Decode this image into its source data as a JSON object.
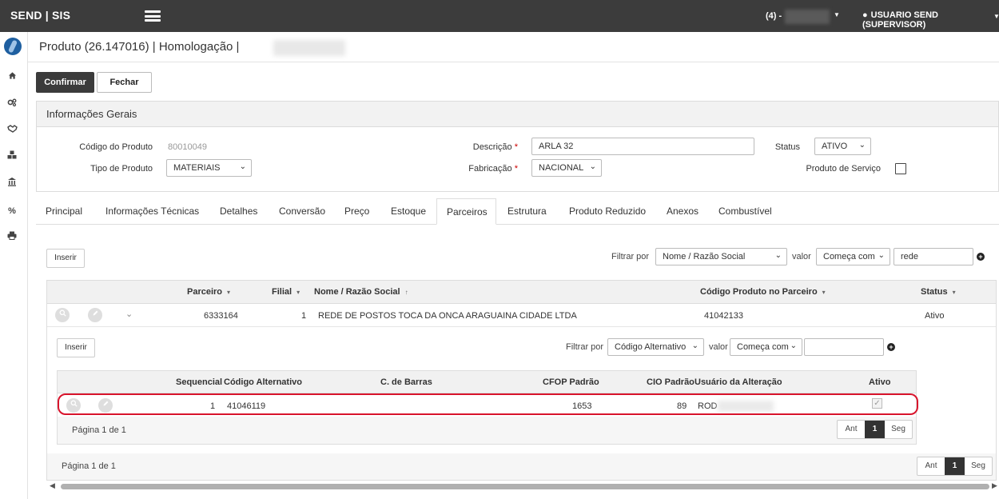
{
  "topbar": {
    "brand": "SEND | SIS",
    "count": "(4) -",
    "user": "USUARIO SEND (SUPERVISOR)"
  },
  "header": {
    "title": "Produto (26.147016) | Homologação |"
  },
  "toolbar": {
    "confirm_label": "Confirmar",
    "close_label": "Fechar"
  },
  "info": {
    "section_title": "Informações Gerais",
    "codigo_label": "Código do Produto",
    "codigo_value": "80010049",
    "tipo_label": "Tipo de Produto",
    "tipo_value": "MATERIAIS",
    "descricao_label": "Descrição",
    "descricao_value": "ARLA 32",
    "fabricacao_label": "Fabricação",
    "fabricacao_value": "NACIONAL",
    "status_label": "Status",
    "status_value": "ATIVO",
    "servico_label": "Produto de Serviço",
    "required_mark": "*"
  },
  "tabs": [
    "Principal",
    "Informações Técnicas",
    "Detalhes",
    "Conversão",
    "Preço",
    "Estoque",
    "Parceiros",
    "Estrutura",
    "Produto Reduzido",
    "Anexos",
    "Combustível"
  ],
  "active_tab": "Parceiros",
  "partners": {
    "insert_label": "Inserir",
    "filter_label": "Filtrar por",
    "filter_field": "Nome / Razão Social",
    "value_label": "valor",
    "filter_op": "Começa com",
    "filter_value": "rede",
    "columns": {
      "parceiro": "Parceiro",
      "filial": "Filial",
      "nome": "Nome / Razão Social",
      "codigo": "Código Produto no Parceiro",
      "status": "Status"
    },
    "rows": [
      {
        "parceiro": "6333164",
        "filial": "1",
        "nome": "REDE DE POSTOS TOCA DA ONCA ARAGUAINA CIDADE LTDA",
        "codigo": "41042133",
        "status": "Ativo"
      }
    ],
    "pagination_text": "Página 1 de 1",
    "pager": {
      "prev": "Ant",
      "page": "1",
      "next": "Seg"
    }
  },
  "alternatives": {
    "insert_label": "Inserir",
    "filter_label": "Filtrar por",
    "filter_field": "Código Alternativo",
    "value_label": "valor",
    "filter_op": "Começa com",
    "filter_value": "",
    "columns": {
      "sequencial": "Sequencial",
      "codigo_alt": "Código Alternativo",
      "barras": "C. de Barras",
      "cfop": "CFOP Padrão",
      "cio": "CIO Padrão",
      "usuario": "Usuário da Alteração",
      "ativo": "Ativo"
    },
    "rows": [
      {
        "sequencial": "1",
        "codigo_alt": "41046119",
        "barras": "",
        "cfop": "1653",
        "cio": "89",
        "usuario": "ROD",
        "ativo": true
      }
    ],
    "pagination_text": "Página 1 de 1",
    "pager": {
      "prev": "Ant",
      "page": "1",
      "next": "Seg"
    }
  },
  "icons": {
    "caret_down": "▾",
    "sort_up": "↑",
    "chevron_down": "⌄",
    "plus": "+",
    "check": "✓"
  }
}
